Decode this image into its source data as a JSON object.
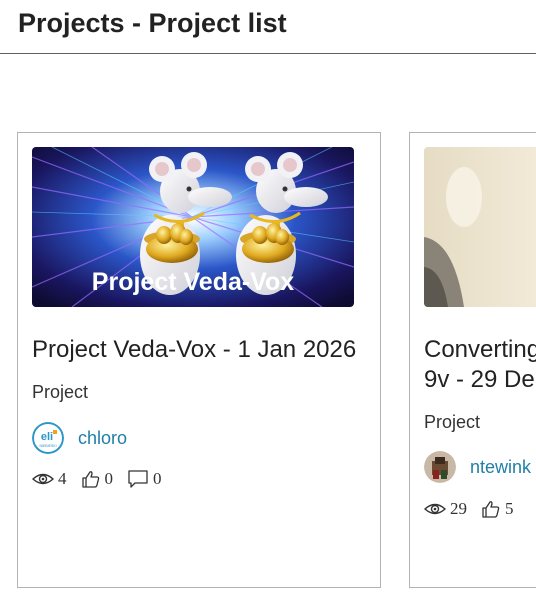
{
  "page": {
    "title": "Projects - Project list"
  },
  "cards": [
    {
      "image_caption": "Project Veda-Vox",
      "title": "Project Veda-Vox - 1 Jan 2026",
      "type": "Project",
      "author": "chloro",
      "avatar_text": "eli",
      "avatar_subtext": "NIEBIESKI",
      "stats": {
        "views": "4",
        "likes": "0",
        "comments": "0"
      }
    },
    {
      "title_line1": "Converting",
      "title_line2": "9v - 29 De",
      "type": "Project",
      "author": "ntewink",
      "stats": {
        "views": "29",
        "likes": "5"
      }
    }
  ],
  "colors": {
    "link": "#1f7fa8",
    "card_border": "#b3b3b3",
    "header_rule": "#5f5f5f"
  },
  "icons": [
    "eye-icon",
    "thumbs-up-icon",
    "comment-icon"
  ]
}
